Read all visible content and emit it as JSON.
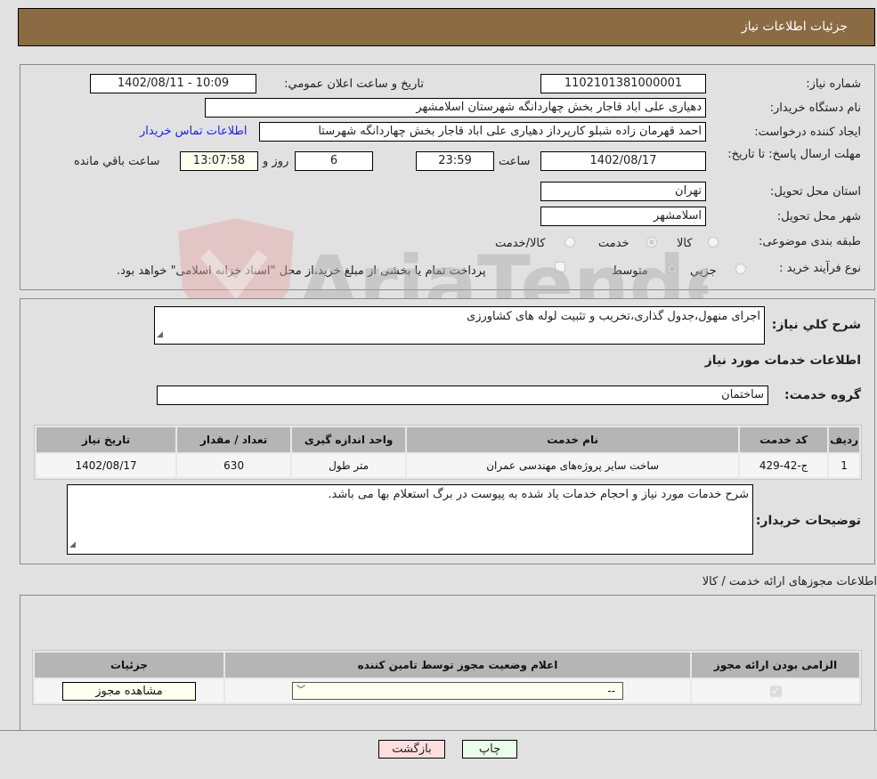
{
  "header": {
    "title": "جزئیات اطلاعات نیاز"
  },
  "info": {
    "need_number_label": "شماره نیاز:",
    "need_number": "1102101381000001",
    "announce_label": "تاریخ و ساعت اعلان عمومي:",
    "announce_value": "1402/08/11 - 10:09",
    "buyer_org_label": "نام دستگاه خریدار:",
    "buyer_org": "دهیاری علی اباد قاجار بخش چهاردانگه شهرستان اسلامشهر",
    "creator_label": "ایجاد کننده درخواست:",
    "creator": "احمد قهرمان زاده شبلو کارپرداز دهیاری علی اباد قاجار بخش چهاردانگه شهرستا",
    "contact_link": "اطلاعات تماس خریدار",
    "deadline_label": "مهلت ارسال پاسخ: تا تاریخ:",
    "deadline_date": "1402/08/17",
    "time_label": "ساعت",
    "deadline_time": "23:59",
    "days": "6",
    "days_label": "روز و",
    "remaining_time": "13:07:58",
    "remaining_label": "ساعت باقي مانده",
    "province_label": "استان محل تحویل:",
    "province": "تهران",
    "city_label": "شهر محل تحویل:",
    "city": "اسلامشهر",
    "category_label": "طبقه بندی موضوعی:",
    "category_options": [
      "کالا",
      "خدمت",
      "کالا/خدمت"
    ],
    "category_selected": "خدمت",
    "process_label": "نوع فرآیند خرید :",
    "process_options": [
      "جزيي",
      "متوسط"
    ],
    "process_selected": "متوسط",
    "treasury_note": "پرداخت تمام یا بخشی از مبلغ خرید،از محل \"اسناد خزانه اسلامی\" خواهد بود."
  },
  "description": {
    "label": "شرح کلي نياز:",
    "value": "اجرای منهول،جدول گذاری،تخریب و تثبیت لوله های کشاورزی"
  },
  "services": {
    "section_title": "اطلاعات خدمات مورد نیاز",
    "group_label": "گروه خدمت:",
    "group_value": "ساختمان",
    "columns": [
      "ردیف",
      "کد خدمت",
      "نام خدمت",
      "واحد اندازه گیری",
      "تعداد / مقدار",
      "تاریخ نیاز"
    ],
    "rows": [
      {
        "row": "1",
        "code": "ج-42-429",
        "name": "ساخت سایر پروژه‌های مهندسی عمران",
        "unit": "متر طول",
        "qty": "630",
        "date": "1402/08/17"
      }
    ]
  },
  "buyer_notes": {
    "label": "توضیحات خریدار:",
    "value": "شرح خدمات مورد نیاز و احجام خدمات یاد شده به پیوست در برگ استعلام بها می باشد."
  },
  "permits": {
    "section_title": "اطلاعات مجوزهای ارائه خدمت / کالا",
    "columns": [
      "الزامی بودن ارائه مجوز",
      "اعلام وضعیت مجوز توسط تامین کننده",
      "جزئیات"
    ],
    "rows": [
      {
        "required": true,
        "status_select": "--",
        "details_button": "مشاهده مجوز"
      }
    ]
  },
  "footer": {
    "print_button": "چاپ",
    "back_button": "بازگشت"
  },
  "watermark": {
    "text": "AriaTender.neT"
  },
  "colors": {
    "header_bg": "#8b6b43",
    "print_bg": "#eaffea",
    "back_bg": "#ffdede",
    "remaining_bg": "#fffff0"
  }
}
